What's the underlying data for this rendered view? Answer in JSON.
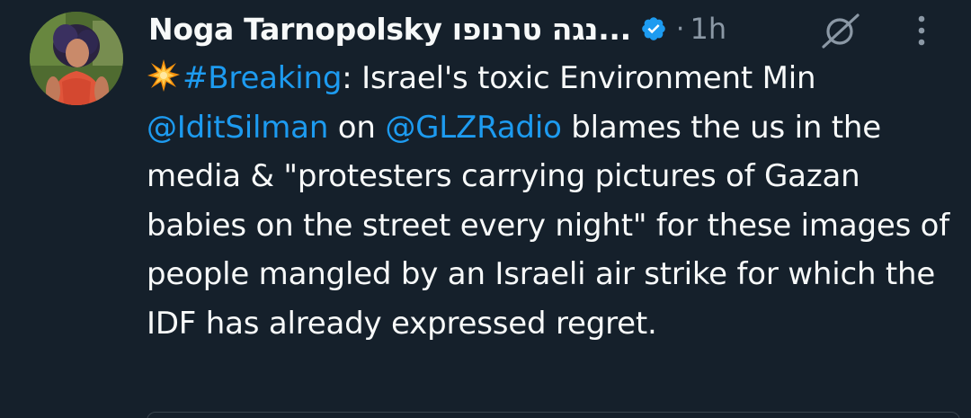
{
  "author": {
    "display_name": "Noga Tarnopolsky נגה טרנופו...",
    "verified": true,
    "avatar_icon": "profile-photo"
  },
  "meta": {
    "separator": "·",
    "time": "1h"
  },
  "icons": {
    "grok": "grok-icon",
    "more": "more-vertical-icon",
    "verified": "verified-badge-icon",
    "collision": "collision-emoji-icon"
  },
  "tweet": {
    "hashtag": "#Breaking",
    "text_1": ": Israel's toxic Environment Min ",
    "mention_1": "@IditSilman",
    "text_2": " on ",
    "mention_2": "@GLZRadio",
    "text_3": " blames the us in the media & \"protesters carrying pictures of Gazan babies on the street every night\" for these images of people mangled by an Israeli air strike for which the IDF has already expressed regret."
  },
  "colors": {
    "background": "#15202b",
    "text": "#f7f9f9",
    "muted": "#8b98a5",
    "link": "#1d9bf0",
    "border": "#38444d"
  }
}
